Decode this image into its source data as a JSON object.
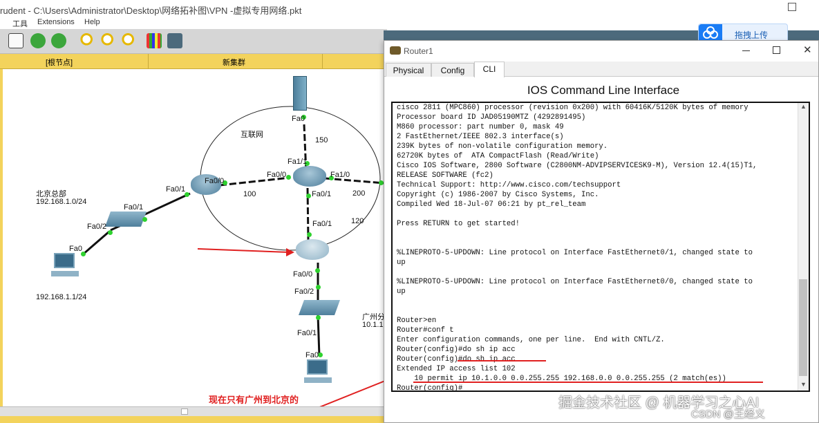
{
  "background_window": {
    "title": "rudent - C:\\Users\\Administrator\\Desktop\\网络拓补图\\VPN -虚拟专用网络.pkt",
    "menu": [
      "工具",
      "Extensions",
      "Help"
    ],
    "tabstrip": {
      "left": "[根节点]",
      "right": "新集群"
    }
  },
  "topology": {
    "labels": {
      "internet": "互联网",
      "beijing_title": "北京总部",
      "beijing_net": "192.168.1.0/24",
      "beijing_pc_ip": "192.168.1.1/24",
      "guangzhou_title": "广州分",
      "guangzhou_net": "10.1.1"
    },
    "interfaces": {
      "server_fa0": "Fa0",
      "core_fa1_1": "Fa1/1",
      "core_fa0_0": "Fa0/0",
      "core_fa1_0": "Fa1/0",
      "core_fa0_1": "Fa0/1",
      "bj_router_fa0_0": "Fa0/0",
      "bj_router_fa0_1": "Fa0/1",
      "bj_switch_fa0_1": "Fa0/1",
      "bj_switch_fa0_2": "Fa0/2",
      "bj_pc_fa0": "Fa0",
      "gz_router_fa0_1": "Fa0/1",
      "gz_router_fa0_0": "Fa0/0",
      "gz_switch_fa0_2": "Fa0/2",
      "gz_switch_fa0_1": "Fa0/1",
      "gz_pc_fa0": "Fa0"
    },
    "link_costs": {
      "server": "150",
      "bj": "100",
      "right": "200",
      "gz": "120"
    },
    "annotation": "现在只有广州到北京的"
  },
  "dialog": {
    "title": "Router1",
    "tabs": [
      {
        "label": "Physical",
        "active": false
      },
      {
        "label": "Config",
        "active": false
      },
      {
        "label": "CLI",
        "active": true
      }
    ],
    "heading": "IOS Command Line Interface",
    "cli_lines": [
      "cisco 2811 (MPC860) processor (revision 0x200) with 60416K/5120K bytes of memory",
      "Processor board ID JAD05190MTZ (4292891495)",
      "M860 processor: part number 0, mask 49",
      "2 FastEthernet/IEEE 802.3 interface(s)",
      "239K bytes of non-volatile configuration memory.",
      "62720K bytes of  ATA CompactFlash (Read/Write)",
      "Cisco IOS Software, 2800 Software (C2800NM-ADVIPSERVICESK9-M), Version 12.4(15)T1,",
      "RELEASE SOFTWARE (fc2)",
      "Technical Support: http://www.cisco.com/techsupport",
      "Copyright (c) 1986-2007 by Cisco Systems, Inc.",
      "Compiled Wed 18-Jul-07 06:21 by pt_rel_team",
      "",
      "Press RETURN to get started!",
      "",
      "",
      "%LINEPROTO-5-UPDOWN: Line protocol on Interface FastEthernet0/1, changed state to",
      "up",
      "",
      "%LINEPROTO-5-UPDOWN: Line protocol on Interface FastEthernet0/0, changed state to",
      "up",
      "",
      "",
      "Router>en",
      "Router#conf t",
      "Enter configuration commands, one per line.  End with CNTL/Z.",
      "Router(config)#do sh ip acc",
      "Router(config)#do sh ip acc",
      "Extended IP access list 102",
      "    10 permit ip 10.1.0.0 0.0.255.255 192.168.0.0 0.0.255.255 (2 match(es))",
      "Router(config)#"
    ]
  },
  "upload_button": {
    "label": "拖拽上传"
  },
  "watermarks": {
    "main": "掘金技术社区 @ 机器学习之心AI",
    "sub": "CSDN @王经义"
  },
  "colors": {
    "link_dot": "#2fd22f",
    "annotation_red": "#e02020",
    "tabstrip": "#f3d35c",
    "upload_blue": "#1a7cf5"
  }
}
